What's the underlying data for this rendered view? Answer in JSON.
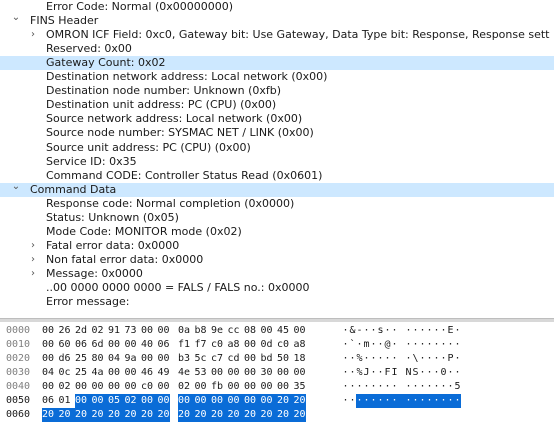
{
  "tree": [
    {
      "text": "Error Code: Normal (0x00000000)",
      "indent": 3,
      "arrow": "",
      "selected": false
    },
    {
      "text": "FINS Header",
      "indent": 1,
      "arrow": "down",
      "selected": false
    },
    {
      "text": "OMRON ICF Field: 0xc0, Gateway bit: Use Gateway, Data Type bit: Response, Response sett",
      "indent": 2,
      "arrow": "right",
      "selected": false
    },
    {
      "text": "Reserved: 0x00",
      "indent": 3,
      "arrow": "",
      "selected": false
    },
    {
      "text": "Gateway Count: 0x02",
      "indent": 3,
      "arrow": "",
      "selected": true
    },
    {
      "text": "Destination network address: Local network (0x00)",
      "indent": 3,
      "arrow": "",
      "selected": false
    },
    {
      "text": "Destination node number: Unknown (0xfb)",
      "indent": 3,
      "arrow": "",
      "selected": false
    },
    {
      "text": "Destination unit address: PC (CPU) (0x00)",
      "indent": 3,
      "arrow": "",
      "selected": false
    },
    {
      "text": "Source network address: Local network (0x00)",
      "indent": 3,
      "arrow": "",
      "selected": false
    },
    {
      "text": "Source node number: SYSMAC NET / LINK (0x00)",
      "indent": 3,
      "arrow": "",
      "selected": false
    },
    {
      "text": "Source unit address: PC (CPU) (0x00)",
      "indent": 3,
      "arrow": "",
      "selected": false
    },
    {
      "text": "Service ID: 0x35",
      "indent": 3,
      "arrow": "",
      "selected": false
    },
    {
      "text": "Command CODE: Controller Status Read (0x0601)",
      "indent": 3,
      "arrow": "",
      "selected": false
    },
    {
      "text": "Command Data",
      "indent": 1,
      "arrow": "down",
      "selected": true
    },
    {
      "text": "Response code: Normal completion (0x0000)",
      "indent": 3,
      "arrow": "",
      "selected": false
    },
    {
      "text": "Status: Unknown (0x05)",
      "indent": 3,
      "arrow": "",
      "selected": false
    },
    {
      "text": "Mode Code: MONITOR mode (0x02)",
      "indent": 3,
      "arrow": "",
      "selected": false
    },
    {
      "text": "Fatal error data: 0x0000",
      "indent": 2,
      "arrow": "right",
      "selected": false
    },
    {
      "text": "Non fatal error data: 0x0000",
      "indent": 2,
      "arrow": "right",
      "selected": false
    },
    {
      "text": "Message: 0x0000",
      "indent": 2,
      "arrow": "right",
      "selected": false
    },
    {
      "text": "..00 0000 0000 0000 = FALS / FALS no.: 0x0000",
      "indent": 3,
      "arrow": "",
      "selected": false
    },
    {
      "text": "Error message:",
      "indent": 3,
      "arrow": "",
      "selected": false
    }
  ],
  "hex": [
    {
      "offset": "0000",
      "bytes": [
        "00",
        "26",
        "2d",
        "02",
        "91",
        "73",
        "00",
        "00",
        "0a",
        "b8",
        "9e",
        "cc",
        "08",
        "00",
        "45",
        "00"
      ],
      "ascii": "·&-··s·· ······E·"
    },
    {
      "offset": "0010",
      "bytes": [
        "00",
        "60",
        "06",
        "6d",
        "00",
        "00",
        "40",
        "06",
        "f1",
        "f7",
        "c0",
        "a8",
        "00",
        "0d",
        "c0",
        "a8"
      ],
      "ascii": "·`·m··@· ········"
    },
    {
      "offset": "0020",
      "bytes": [
        "00",
        "d6",
        "25",
        "80",
        "04",
        "9a",
        "00",
        "00",
        "b3",
        "5c",
        "c7",
        "cd",
        "00",
        "bd",
        "50",
        "18"
      ],
      "ascii": "··%····· ·\\····P·"
    },
    {
      "offset": "0030",
      "bytes": [
        "04",
        "0c",
        "25",
        "4a",
        "00",
        "00",
        "46",
        "49",
        "4e",
        "53",
        "00",
        "00",
        "00",
        "30",
        "00",
        "00"
      ],
      "ascii": "··%J··FI NS···0··"
    },
    {
      "offset": "0040",
      "bytes": [
        "00",
        "02",
        "00",
        "00",
        "00",
        "00",
        "c0",
        "00",
        "02",
        "00",
        "fb",
        "00",
        "00",
        "00",
        "00",
        "35"
      ],
      "ascii": "········ ·······5"
    },
    {
      "offset": "0050",
      "bytes": [
        "06",
        "01",
        "00",
        "00",
        "05",
        "02",
        "00",
        "00",
        "00",
        "00",
        "00",
        "00",
        "00",
        "00",
        "20",
        "20"
      ],
      "ascii": "········ ········"
    },
    {
      "offset": "0060",
      "bytes": [
        "20",
        "20",
        "20",
        "20",
        "20",
        "20",
        "20",
        "20",
        "20",
        "20",
        "20",
        "20",
        "20",
        "20",
        "20",
        "20"
      ],
      "ascii": ""
    }
  ],
  "colors": {
    "selected_row": "#cde8ff",
    "hex_highlight": "#0a6cd7"
  }
}
